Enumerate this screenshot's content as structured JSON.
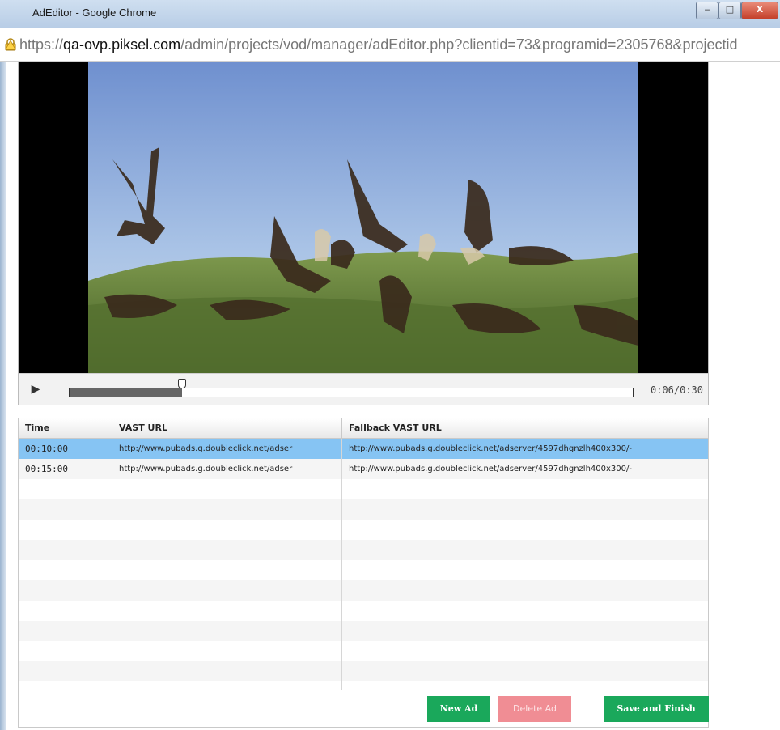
{
  "window": {
    "title": "AdEditor - Google Chrome",
    "minimize_label": "‒",
    "maximize_label": "□",
    "close_label": "X"
  },
  "address": {
    "protocol": "https://",
    "host": "qa-ovp.piksel.com",
    "path": "/admin/projects/vod/manager/adEditor.php?clientid=73&programid=2305768&projectid"
  },
  "player": {
    "play_icon": "play-icon",
    "time": "0:06/0:30",
    "progress": 0.2
  },
  "grid": {
    "columns": [
      "Time",
      "VAST URL",
      "Fallback VAST URL"
    ],
    "rows": [
      {
        "time": "00:10:00",
        "vast": "http://www.pubads.g.doubleclick.net/adser",
        "fallback": "http://www.pubads.g.doubleclick.net/adserver/4597dhgnzlh400x300/-",
        "selected": true
      },
      {
        "time": "00:15:00",
        "vast": "http://www.pubads.g.doubleclick.net/adser",
        "fallback": "http://www.pubads.g.doubleclick.net/adserver/4597dhgnzlh400x300/-",
        "selected": false
      },
      {
        "time": "",
        "vast": "",
        "fallback": "",
        "selected": false
      },
      {
        "time": "",
        "vast": "",
        "fallback": "",
        "selected": false
      },
      {
        "time": "",
        "vast": "",
        "fallback": "",
        "selected": false
      },
      {
        "time": "",
        "vast": "",
        "fallback": "",
        "selected": false
      },
      {
        "time": "",
        "vast": "",
        "fallback": "",
        "selected": false
      },
      {
        "time": "",
        "vast": "",
        "fallback": "",
        "selected": false
      },
      {
        "time": "",
        "vast": "",
        "fallback": "",
        "selected": false
      },
      {
        "time": "",
        "vast": "",
        "fallback": "",
        "selected": false
      },
      {
        "time": "",
        "vast": "",
        "fallback": "",
        "selected": false
      },
      {
        "time": "",
        "vast": "",
        "fallback": "",
        "selected": false
      },
      {
        "time": "",
        "vast": "",
        "fallback": "",
        "selected": false
      }
    ]
  },
  "buttons": {
    "new_ad": "New Ad",
    "delete_ad": "Delete Ad",
    "save_finish": "Save and Finish"
  },
  "colors": {
    "accent_green": "#1aa85b",
    "delete_pink": "#f08d94",
    "selected_row": "#86c4f3"
  }
}
